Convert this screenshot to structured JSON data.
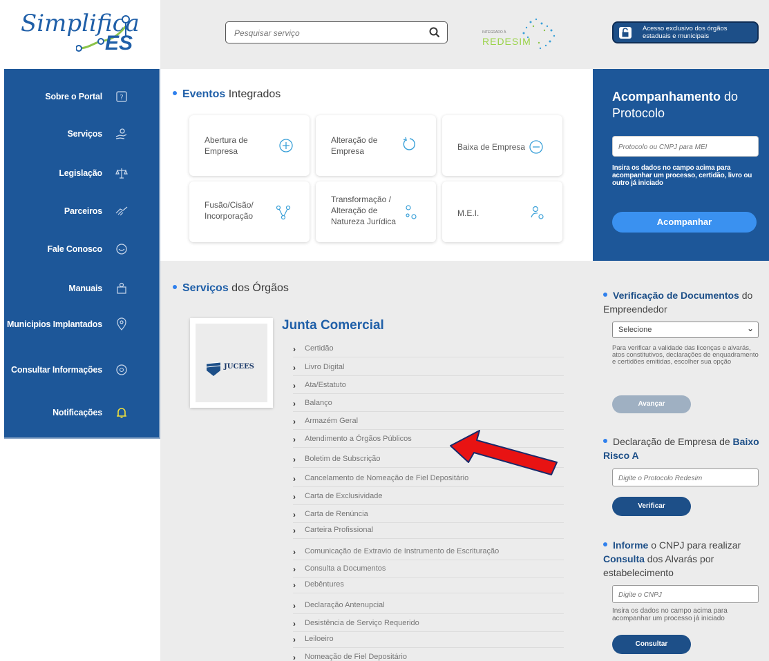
{
  "header": {
    "logo_text_main": "Simplifica",
    "logo_text_suffix": "ES",
    "search_placeholder": "Pesquisar serviço",
    "redesim_small": "INTEGRADO À",
    "redesim_text": "REDESIM",
    "access_button_label": "Acesso exclusivo dos órgãos estaduais e municipais"
  },
  "sidebar": {
    "items": [
      {
        "label": "Sobre o Portal",
        "icon": "question-icon"
      },
      {
        "label": "Serviços",
        "icon": "hand-icon"
      },
      {
        "label": "Legislação",
        "icon": "scale-icon"
      },
      {
        "label": "Parceiros",
        "icon": "handshake-icon"
      },
      {
        "label": "Fale Conosco",
        "icon": "chat-icon"
      },
      {
        "label": "Manuais",
        "icon": "book-icon"
      },
      {
        "label": "Municipios Implantados",
        "icon": "map-pin-icon"
      },
      {
        "label": "Consultar Informações",
        "icon": "info-icon"
      },
      {
        "label": "Notificações",
        "icon": "bell-icon"
      }
    ]
  },
  "eventos": {
    "title_prefix": "Eventos",
    "title_suffix": " Integrados",
    "cards": [
      {
        "label": "Abertura de Empresa",
        "icon": "plus-circle-icon"
      },
      {
        "label": "Alteração de Empresa",
        "icon": "refresh-icon"
      },
      {
        "label": "Baixa de Empresa",
        "icon": "minus-circle-icon"
      },
      {
        "label": "Fusão/Cisão/ Incorporação",
        "icon": "merge-icon"
      },
      {
        "label": "Transformação / Alteração de Natureza Jurídica",
        "icon": "transform-icon"
      },
      {
        "label": "M.E.I.",
        "icon": "user-cog-icon"
      }
    ]
  },
  "servicos": {
    "title_prefix": "Serviços",
    "title_suffix": " dos Órgãos",
    "org_name": "Junta Comercial",
    "org_logo_text": "JUCEES",
    "items": [
      "Certidão",
      "Livro Digital",
      "Ata/Estatuto",
      "Balanço",
      "Armazém Geral",
      "Atendimento a Órgãos Públicos",
      "Boletim de Subscrição",
      "Cancelamento de Nomeação de Fiel Depositário",
      "Carta de Exclusividade",
      "Carta de Renúncia",
      "Carteira Profissional",
      "Comunicação de Extravio de Instrumento de Escrituração",
      "Consulta a Documentos",
      "Debêntures",
      "Declaração Antenupcial",
      "Desistência de Serviço Requerido",
      "Leiloeiro",
      "Nomeação de Fiel Depositário"
    ]
  },
  "acompanhamento": {
    "title_bold": "Acompanhamento",
    "title_rest": " do Protocolo",
    "input_placeholder": "Protocolo ou CNPJ para MEI",
    "description": "Insira os dados no campo acima para acompanhar um processo, certidão, livro ou outro já iniciado",
    "button_label": "Acompanhar"
  },
  "verificacao": {
    "title_bold": "Verificação de Documentos",
    "title_rest": " do Empreendedor",
    "select_value": "Selecione",
    "description": "Para verificar a validade das licenças e alvarás, atos constitutivos, declarações de enquadramento e certidões emitidas, escolher sua opção",
    "button_label": "Avançar"
  },
  "declaracao": {
    "title_plain": "Declaração de Empresa de ",
    "title_bold": "Baixo Risco A",
    "input_placeholder": "Digite o Protocolo Redesim",
    "button_label": "Verificar"
  },
  "informe": {
    "t1_bold": "Informe",
    "t1_rest": " o CNPJ para realizar",
    "t2_bold": "Consulta",
    "t2_rest": " dos Alvarás por estabelecimento",
    "input_placeholder": "Digite o CNPJ",
    "description": "Insira os dados no campo acima para acompanhar um processo já iniciado",
    "button_label": "Consultar"
  },
  "colors": {
    "primary": "#1d5799",
    "accent": "#2f80ed",
    "arrow": "#e81313"
  }
}
